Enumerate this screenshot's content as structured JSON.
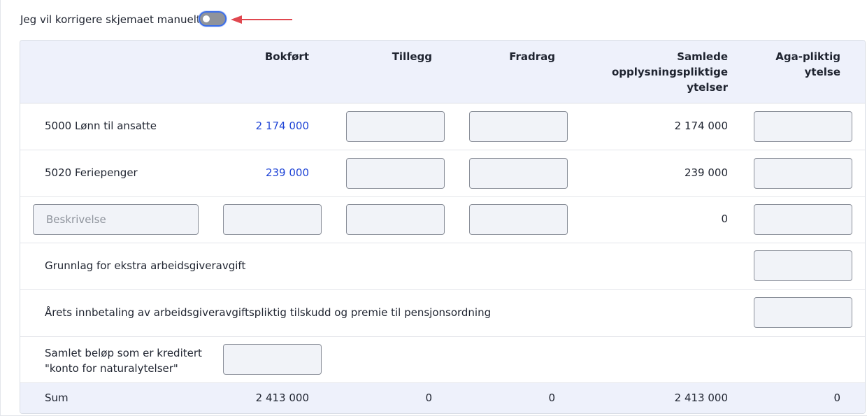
{
  "toggle": {
    "label": "Jeg vil korrigere skjemaet manuelt",
    "on": false
  },
  "colors": {
    "accent": "#3b6ee8",
    "link": "#1f44d6",
    "arrow": "#e0474f",
    "header_bg": "#eef1fb"
  },
  "columns": {
    "bokfort": "Bokført",
    "tillegg": "Tillegg",
    "fradrag": "Fradrag",
    "samlede_1": "Samlede",
    "samlede_2": "opplysningspliktige",
    "samlede_3": "ytelser",
    "aga_1": "Aga-pliktig",
    "aga_2": "ytelse"
  },
  "rows": {
    "lonn": {
      "label": "5000 Lønn til ansatte",
      "bokfort": "2 174 000",
      "samlede": "2 174 000"
    },
    "ferie": {
      "label": "5020 Feriepenger",
      "bokfort": "239 000",
      "samlede": "239 000"
    },
    "custom": {
      "description_placeholder": "Beskrivelse",
      "samlede": "0"
    },
    "grunnlag": {
      "label": "Grunnlag for ekstra arbeidsgiveravgift"
    },
    "pensjon": {
      "label": "Årets innbetaling av arbeidsgiveravgiftspliktig tilskudd og premie til pensjonsordning"
    },
    "natural": {
      "label_1": "Samlet beløp som er kreditert",
      "label_2": "\"konto for naturalytelser\""
    },
    "sum": {
      "label": "Sum",
      "bokfort": "2 413 000",
      "tillegg": "0",
      "fradrag": "0",
      "samlede": "2 413 000",
      "aga": "0"
    }
  }
}
